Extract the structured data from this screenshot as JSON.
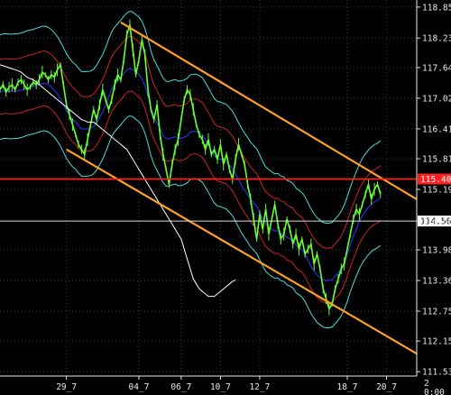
{
  "chart_data": {
    "type": "line",
    "y_ticks": [
      "118.858",
      "118.236",
      "117.644",
      "117.028",
      "116.413",
      "115.813",
      "115.197",
      "114.562",
      "113.983",
      "113.368",
      "112.753",
      "112.153",
      "111.538"
    ],
    "ylim": [
      111.45,
      119.0
    ],
    "x_ticks": [
      "29_7",
      "04_7",
      "06_7",
      "10_7",
      "12_7",
      "18_7",
      "20_7"
    ],
    "x_tick_values": [
      22,
      46,
      60,
      73,
      86,
      115,
      128
    ],
    "x_last_tick": [
      "2",
      "0:00"
    ],
    "x_range": [
      0,
      138
    ],
    "horizontal_lines": [
      {
        "value": 115.406,
        "label": "115.406",
        "color": "#ff2020"
      },
      {
        "value": 114.562,
        "label": "114.562",
        "color": "#d8d8d8"
      }
    ],
    "trend_lines": [
      {
        "from": [
          40,
          118.55
        ],
        "to": [
          138,
          115.0
        ],
        "color": "#ffa020"
      },
      {
        "from": [
          22,
          116.0
        ],
        "to": [
          138,
          111.9
        ],
        "color": "#ffa020"
      }
    ],
    "series": [
      {
        "color": "#66ff33",
        "values": [
          117.2,
          117.3,
          117.15,
          117.25,
          117.3,
          117.2,
          117.35,
          117.4,
          117.3,
          117.2,
          117.25,
          117.35,
          117.3,
          117.4,
          117.55,
          117.5,
          117.4,
          117.5,
          117.45,
          117.6,
          117.7,
          117.3,
          116.9,
          116.7,
          116.5,
          116.3,
          116.1,
          116.0,
          115.9,
          116.2,
          116.5,
          116.8,
          116.6,
          116.9,
          117.2,
          117.0,
          116.8,
          117.0,
          117.3,
          117.5,
          117.4,
          117.8,
          118.3,
          118.5,
          118.0,
          117.5,
          117.8,
          118.2,
          117.9,
          117.2,
          116.8,
          116.6,
          116.9,
          116.3,
          115.9,
          115.6,
          115.3,
          115.7,
          116.0,
          116.2,
          116.6,
          117.0,
          117.2,
          117.1,
          116.8,
          116.5,
          116.3,
          116.2,
          116.0,
          116.2,
          115.9,
          116.0,
          115.8,
          116.1,
          115.7,
          115.9,
          115.6,
          115.4,
          115.8,
          116.1,
          115.9,
          115.7,
          115.3,
          115.0,
          114.6,
          114.2,
          114.7,
          114.4,
          114.8,
          114.3,
          114.6,
          114.9,
          114.5,
          114.2,
          114.3,
          114.6,
          114.4,
          114.1,
          114.3,
          114.0,
          114.2,
          113.9,
          114.0,
          114.1,
          113.7,
          113.9,
          113.6,
          113.2,
          113.0,
          112.8,
          112.9,
          113.2,
          113.4,
          113.6,
          113.7,
          114.0,
          114.3,
          114.6,
          114.8,
          114.7,
          114.9,
          115.1,
          115.3,
          115.0,
          115.2,
          115.3,
          115.1
        ]
      },
      {
        "color": "#ffffff",
        "values": [
          117.7,
          117.68,
          117.66,
          117.64,
          117.62,
          117.6,
          117.58,
          117.55,
          117.5,
          117.45,
          117.42,
          117.4,
          117.35,
          117.3,
          117.25,
          117.2,
          117.15,
          117.1,
          117.05,
          117.0,
          116.95,
          116.9,
          116.85,
          116.8,
          116.75,
          116.7,
          116.65,
          116.6,
          116.58,
          116.55,
          116.55,
          116.55,
          116.5,
          116.45,
          116.4,
          116.35,
          116.3,
          116.25,
          116.2,
          116.15,
          116.1,
          116.05,
          116.0,
          115.9,
          115.8,
          115.7,
          115.6,
          115.5,
          115.4,
          115.3,
          115.2,
          115.1,
          115.0,
          114.9,
          114.8,
          114.7,
          114.6,
          114.5,
          114.4,
          114.3,
          114.2,
          114.0,
          113.8,
          113.6,
          113.4,
          113.3,
          113.2,
          113.15,
          113.1,
          113.05,
          113.05,
          113.05,
          113.1,
          113.15,
          113.2,
          113.25,
          113.3,
          113.35,
          113.38
        ]
      }
    ]
  }
}
